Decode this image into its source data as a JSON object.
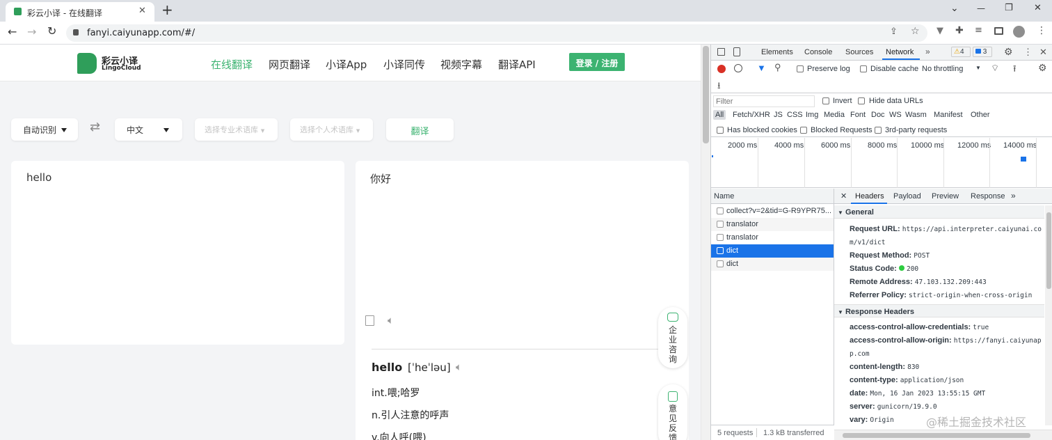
{
  "browser": {
    "tab_title": "彩云小译 - 在线翻译",
    "new_tab": "+",
    "url": "fanyi.caiyunapp.com/#/",
    "window_controls": [
      "⌄",
      "—",
      "❐",
      "✕"
    ]
  },
  "site": {
    "logo_title": "彩云小译",
    "logo_sub": "LingoCloud",
    "nav": [
      "在线翻译",
      "网页翻译",
      "小译App",
      "小译同传",
      "视频字幕",
      "翻译API"
    ],
    "login_button": "登录 / 注册",
    "source_lang": "自动识别",
    "target_lang": "中文",
    "term_pro": "选择专业术语库",
    "term_personal": "选择个人术语库",
    "translate_button": "翻译",
    "input_text": "hello",
    "output_text": "你好",
    "dict_word": "hello",
    "dict_phonetic": "[ˈheˈləu]",
    "dict_defs": [
      "int.喂;哈罗",
      "n.引人注意的呼声",
      "v.向人呼(喂)"
    ],
    "side_enterprise": "企业咨询",
    "side_feedback": "意见反馈"
  },
  "devtools": {
    "tabs": [
      "Elements",
      "Console",
      "Sources",
      "Network"
    ],
    "active_tab": "Network",
    "warn_count": "4",
    "msg_count": "3",
    "preserve_log": "Preserve log",
    "disable_cache": "Disable cache",
    "throttling": "No throttling",
    "filter_placeholder": "Filter",
    "invert": "Invert",
    "hide_data_urls": "Hide data URLs",
    "type_filters": [
      "All",
      "Fetch/XHR",
      "JS",
      "CSS",
      "Img",
      "Media",
      "Font",
      "Doc",
      "WS",
      "Wasm",
      "Manifest",
      "Other"
    ],
    "blocked_cookies": "Has blocked cookies",
    "blocked_requests": "Blocked Requests",
    "third_party": "3rd-party requests",
    "timeline_ticks": [
      "2000 ms",
      "4000 ms",
      "6000 ms",
      "8000 ms",
      "10000 ms",
      "12000 ms",
      "14000 ms"
    ],
    "name_header": "Name",
    "requests": [
      "collect?v=2&tid=G-R9YPR75...",
      "translator",
      "translator",
      "dict",
      "dict"
    ],
    "selected_index": 3,
    "detail_tabs": [
      "Headers",
      "Payload",
      "Preview",
      "Response"
    ],
    "general_title": "General",
    "general": [
      {
        "k": "Request URL:",
        "v": "https://api.interpreter.caiyunai.com/v1/dict"
      },
      {
        "k": "Request Method:",
        "v": "POST"
      },
      {
        "k": "Status Code:",
        "v": "200"
      },
      {
        "k": "Remote Address:",
        "v": "47.103.132.209:443"
      },
      {
        "k": "Referrer Policy:",
        "v": "strict-origin-when-cross-origin"
      }
    ],
    "response_title": "Response Headers",
    "response_headers": [
      {
        "k": "access-control-allow-credentials:",
        "v": "true"
      },
      {
        "k": "access-control-allow-origin:",
        "v": "https://fanyi.caiyunapp.com"
      },
      {
        "k": "content-length:",
        "v": "830"
      },
      {
        "k": "content-type:",
        "v": "application/json"
      },
      {
        "k": "date:",
        "v": "Mon, 16 Jan 2023 13:55:15 GMT"
      },
      {
        "k": "server:",
        "v": "gunicorn/19.9.0"
      },
      {
        "k": "vary:",
        "v": "Origin"
      }
    ],
    "status_requests": "5 requests",
    "status_transferred": "1.3 kB transferred",
    "watermark": "@稀土掘金技术社区"
  },
  "colors": {
    "brand_green": "#3cb371",
    "selected_row": "#1a73e8",
    "status_ok": "#2ecc40"
  }
}
